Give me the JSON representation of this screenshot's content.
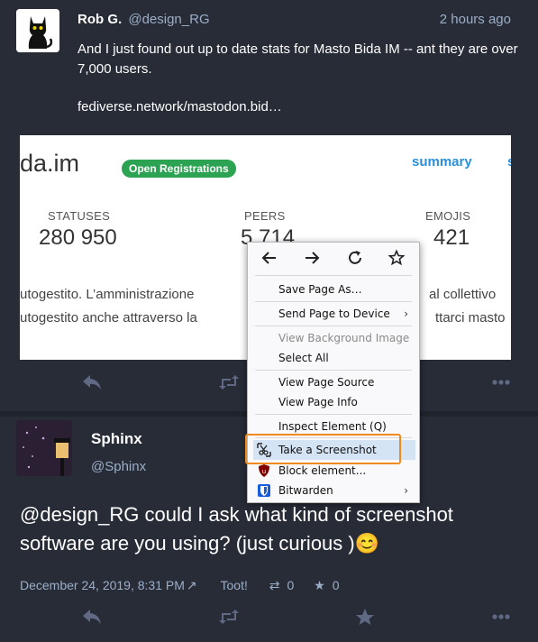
{
  "post1": {
    "display_name": "Rob G.",
    "handle": "@design_RG",
    "time": "2 hours ago",
    "text": "And I just found out up to date stats for Masto Bida IM -- ant they are over 7,000 users.",
    "link": "fediverse.network/mastodon.bid…",
    "card": {
      "domain": "da.im",
      "badge": "Open Registrations",
      "summary": "summary",
      "summary_s": "s",
      "stats": [
        {
          "label": "STATUSES",
          "value": "280 950"
        },
        {
          "label": "PEERS",
          "value": "5 714"
        },
        {
          "label": "EMOJIS",
          "value": "421"
        }
      ],
      "line1_left": "utogestito. L’amministrazione",
      "line1_right": "al collettivo",
      "line2_left": "utogestito anche attraverso la",
      "line2_right": "ttarci masto"
    },
    "actions": {
      "reply": "reply-icon",
      "boost": "boost-icon",
      "more": "more-icon"
    }
  },
  "post2": {
    "display_name": "Sphinx",
    "handle": "@Sphinx",
    "text": "@design_RG could I ask what kind of screenshot software are you using? (just curious )😊",
    "date": "December 24, 2019, 8:31 PM",
    "app": "Toot!",
    "boosts": "0",
    "favs": "0"
  },
  "context_menu": {
    "nav": [
      "back-icon",
      "forward-icon",
      "reload-icon",
      "bookmark-star-icon"
    ],
    "items": [
      {
        "label": "Save Page As…",
        "disabled": false
      },
      {
        "label": "Send Page to Device",
        "disabled": false,
        "submenu": true
      },
      {
        "label": "View Background Image",
        "disabled": true
      },
      {
        "label": "Select All",
        "disabled": false
      },
      {
        "label": "View Page Source",
        "disabled": false
      },
      {
        "label": "View Page Info",
        "disabled": false
      },
      {
        "label": "Inspect Element (Q)",
        "disabled": false
      },
      {
        "label": "Take a Screenshot",
        "disabled": false,
        "highlighted": true
      },
      {
        "label": "Block element...",
        "disabled": false
      },
      {
        "label": "Bitwarden",
        "disabled": false,
        "submenu": true
      }
    ]
  },
  "colors": {
    "background": "#282c37",
    "accent": "#2b90d9",
    "badge": "#2ca352",
    "highlight_border": "#f08a1c"
  }
}
